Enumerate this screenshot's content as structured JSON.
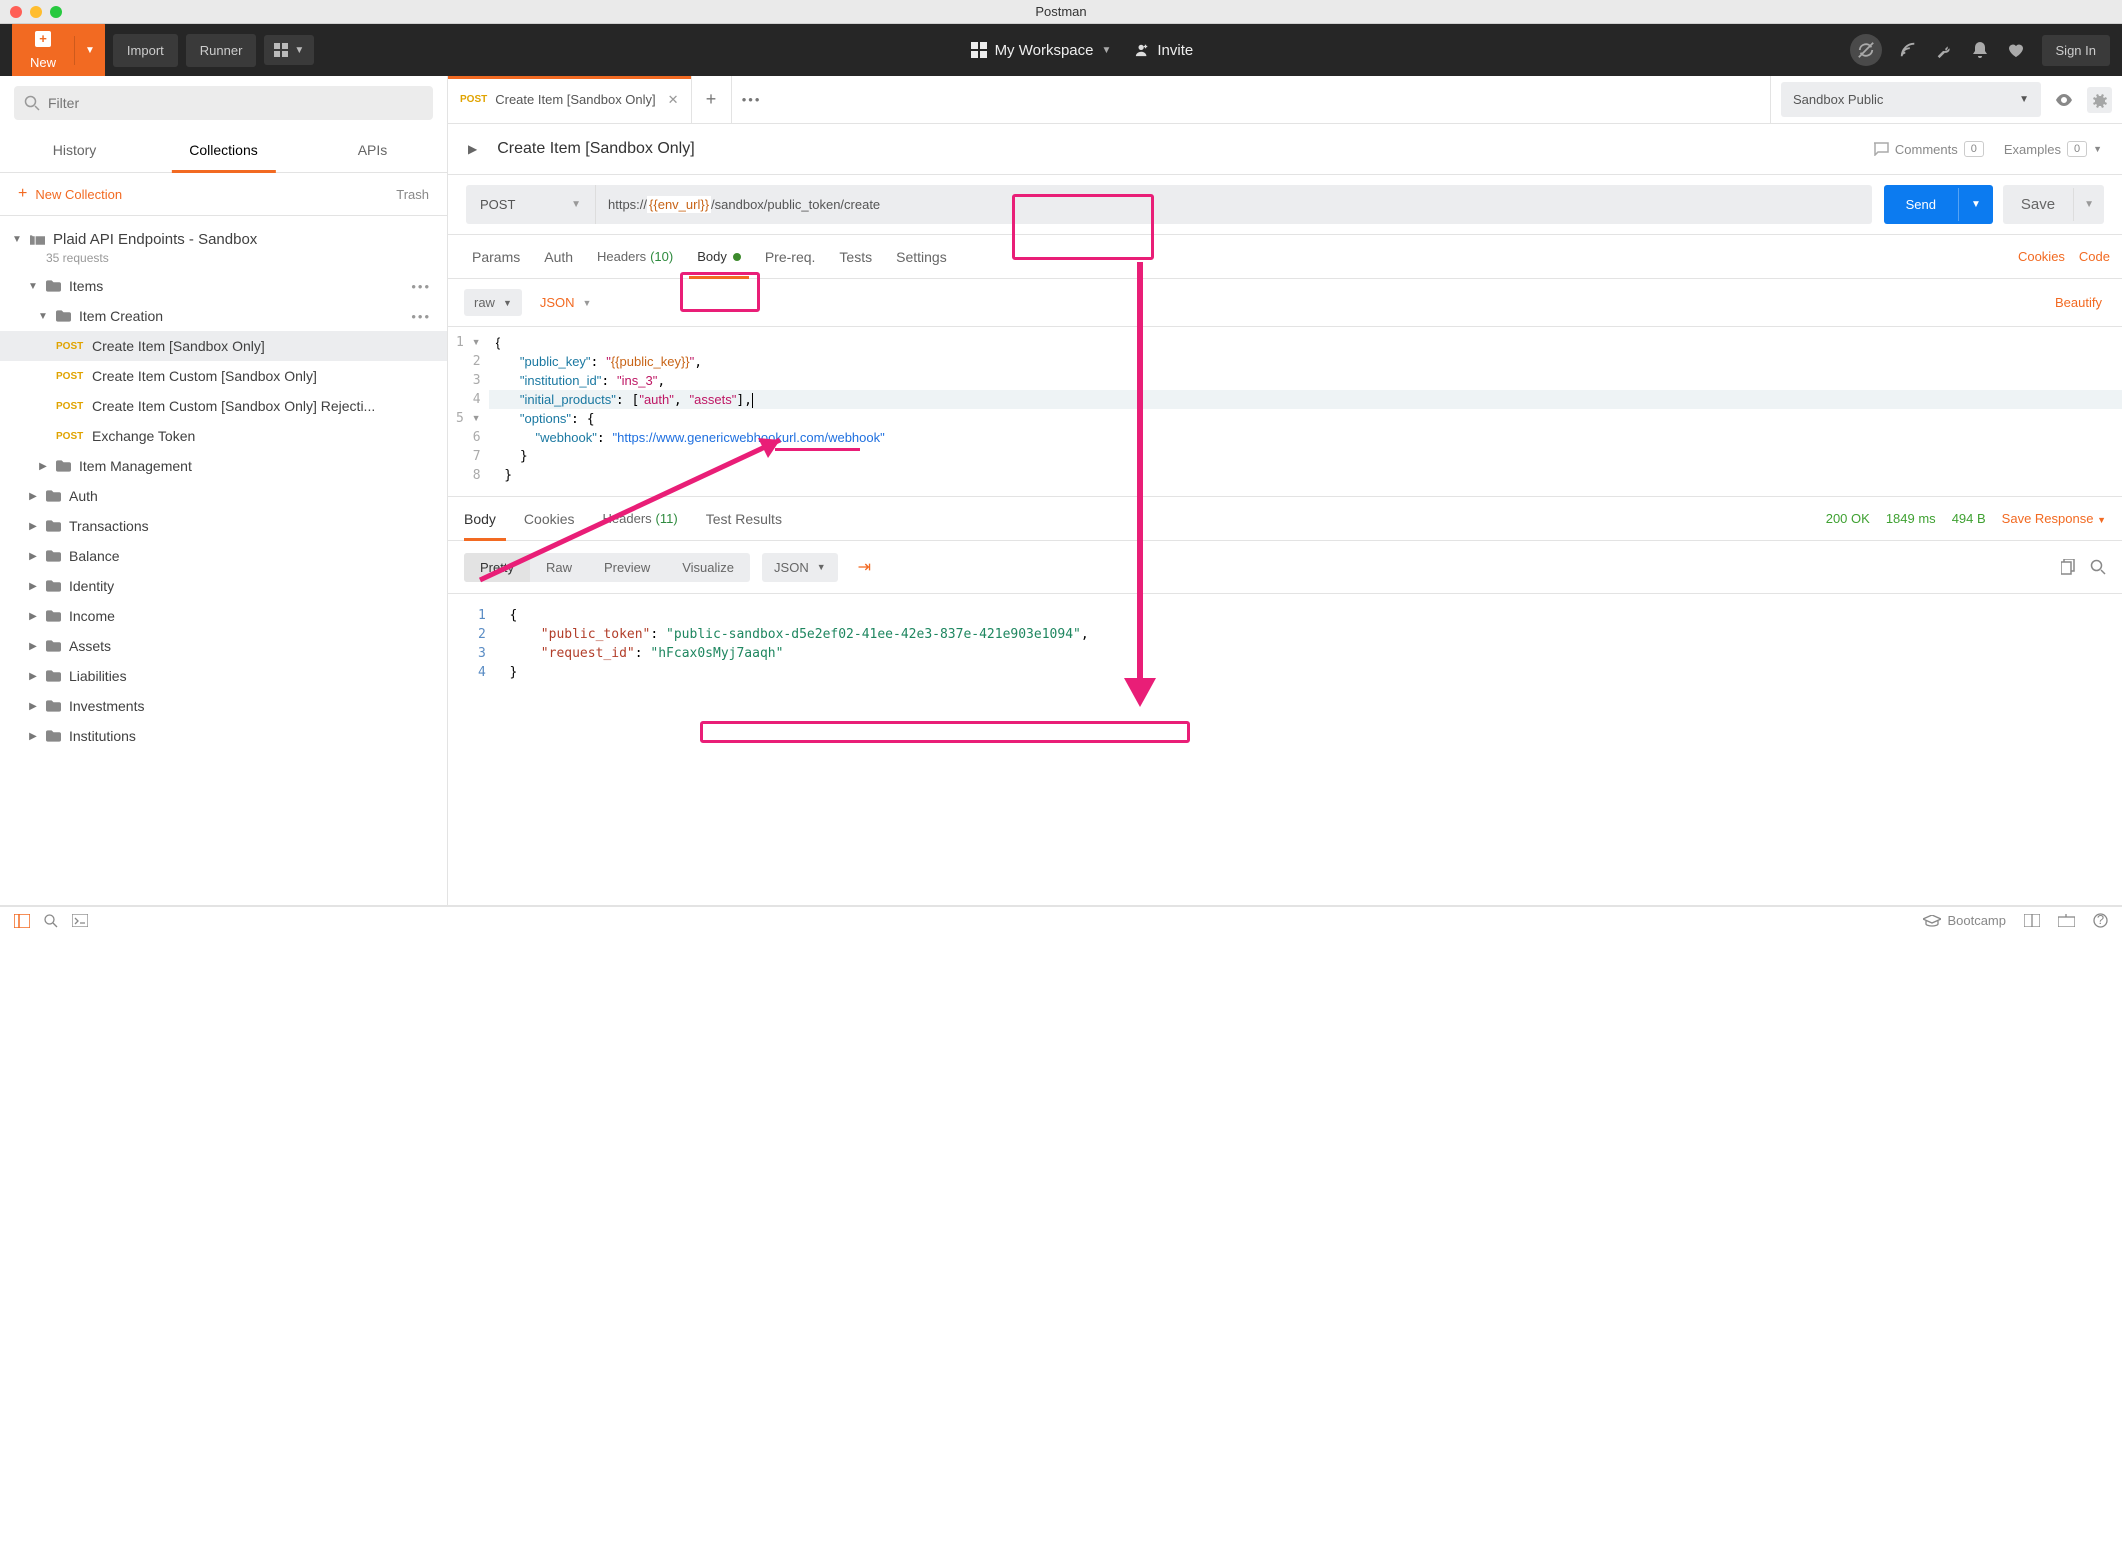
{
  "title_bar": "Postman",
  "top": {
    "new": "New",
    "import": "Import",
    "runner": "Runner",
    "workspace": "My Workspace",
    "invite": "Invite",
    "signin": "Sign In"
  },
  "sidebar": {
    "filter_placeholder": "Filter",
    "tabs": {
      "history": "History",
      "collections": "Collections",
      "apis": "APIs"
    },
    "new_collection": "New Collection",
    "trash": "Trash",
    "collection": {
      "name": "Plaid API Endpoints - Sandbox",
      "requests": "35 requests"
    },
    "folders": {
      "items": "Items",
      "item_creation": "Item Creation",
      "req1": "Create Item [Sandbox Only]",
      "req2": "Create Item Custom [Sandbox Only]",
      "req3": "Create Item Custom [Sandbox Only] Rejecti...",
      "req4": "Exchange Token",
      "item_mgmt": "Item Management",
      "auth": "Auth",
      "transactions": "Transactions",
      "balance": "Balance",
      "identity": "Identity",
      "income": "Income",
      "assets": "Assets",
      "liabilities": "Liabilities",
      "investments": "Investments",
      "institutions": "Institutions"
    }
  },
  "tab": {
    "method": "POST",
    "title": "Create Item [Sandbox Only]"
  },
  "env": {
    "name": "Sandbox Public"
  },
  "req_header": {
    "title": "Create Item [Sandbox Only]",
    "comments": "Comments",
    "comments_n": "0",
    "examples": "Examples",
    "examples_n": "0"
  },
  "url": {
    "method": "POST",
    "pre": "https://",
    "var": "{{env_url}}",
    "post": "/sandbox/public_token/create",
    "send": "Send",
    "save": "Save"
  },
  "req_tabs": {
    "params": "Params",
    "auth": "Auth",
    "headers": "Headers",
    "headers_n": "(10)",
    "body": "Body",
    "prereq": "Pre-req.",
    "tests": "Tests",
    "settings": "Settings",
    "cookies": "Cookies",
    "code": "Code"
  },
  "body_sub": {
    "raw": "raw",
    "json": "JSON",
    "beautify": "Beautify"
  },
  "code": {
    "l1": "  {",
    "l2": "    \"public_key\": \"{{public_key}}\",",
    "l3": "    \"institution_id\": \"ins_3\",",
    "l4": "    \"initial_products\": [\"auth\", \"assets\"],",
    "l5": "    \"options\": {",
    "l6": "      \"webhook\": \"https://www.genericwebhookurl.com/webhook\"",
    "l7": "    }",
    "l8": "  }"
  },
  "resp": {
    "tabs": {
      "body": "Body",
      "cookies": "Cookies",
      "headers": "Headers",
      "headers_n": "(11)",
      "tests": "Test Results"
    },
    "status_lbl": "",
    "status": "200 OK",
    "time": "1849 ms",
    "size": "494 B",
    "save": "Save Response",
    "sub": {
      "pretty": "Pretty",
      "raw": "Raw",
      "preview": "Preview",
      "visualize": "Visualize",
      "json": "JSON"
    },
    "body": {
      "public_token_key": "public_token",
      "public_token": "public-sandbox-d5e2ef02-41ee-42e3-837e-421e903e1094",
      "request_id_key": "request_id",
      "request_id": "hFcax0sMyj7aaqh"
    }
  },
  "status": {
    "bootcamp": "Bootcamp"
  }
}
